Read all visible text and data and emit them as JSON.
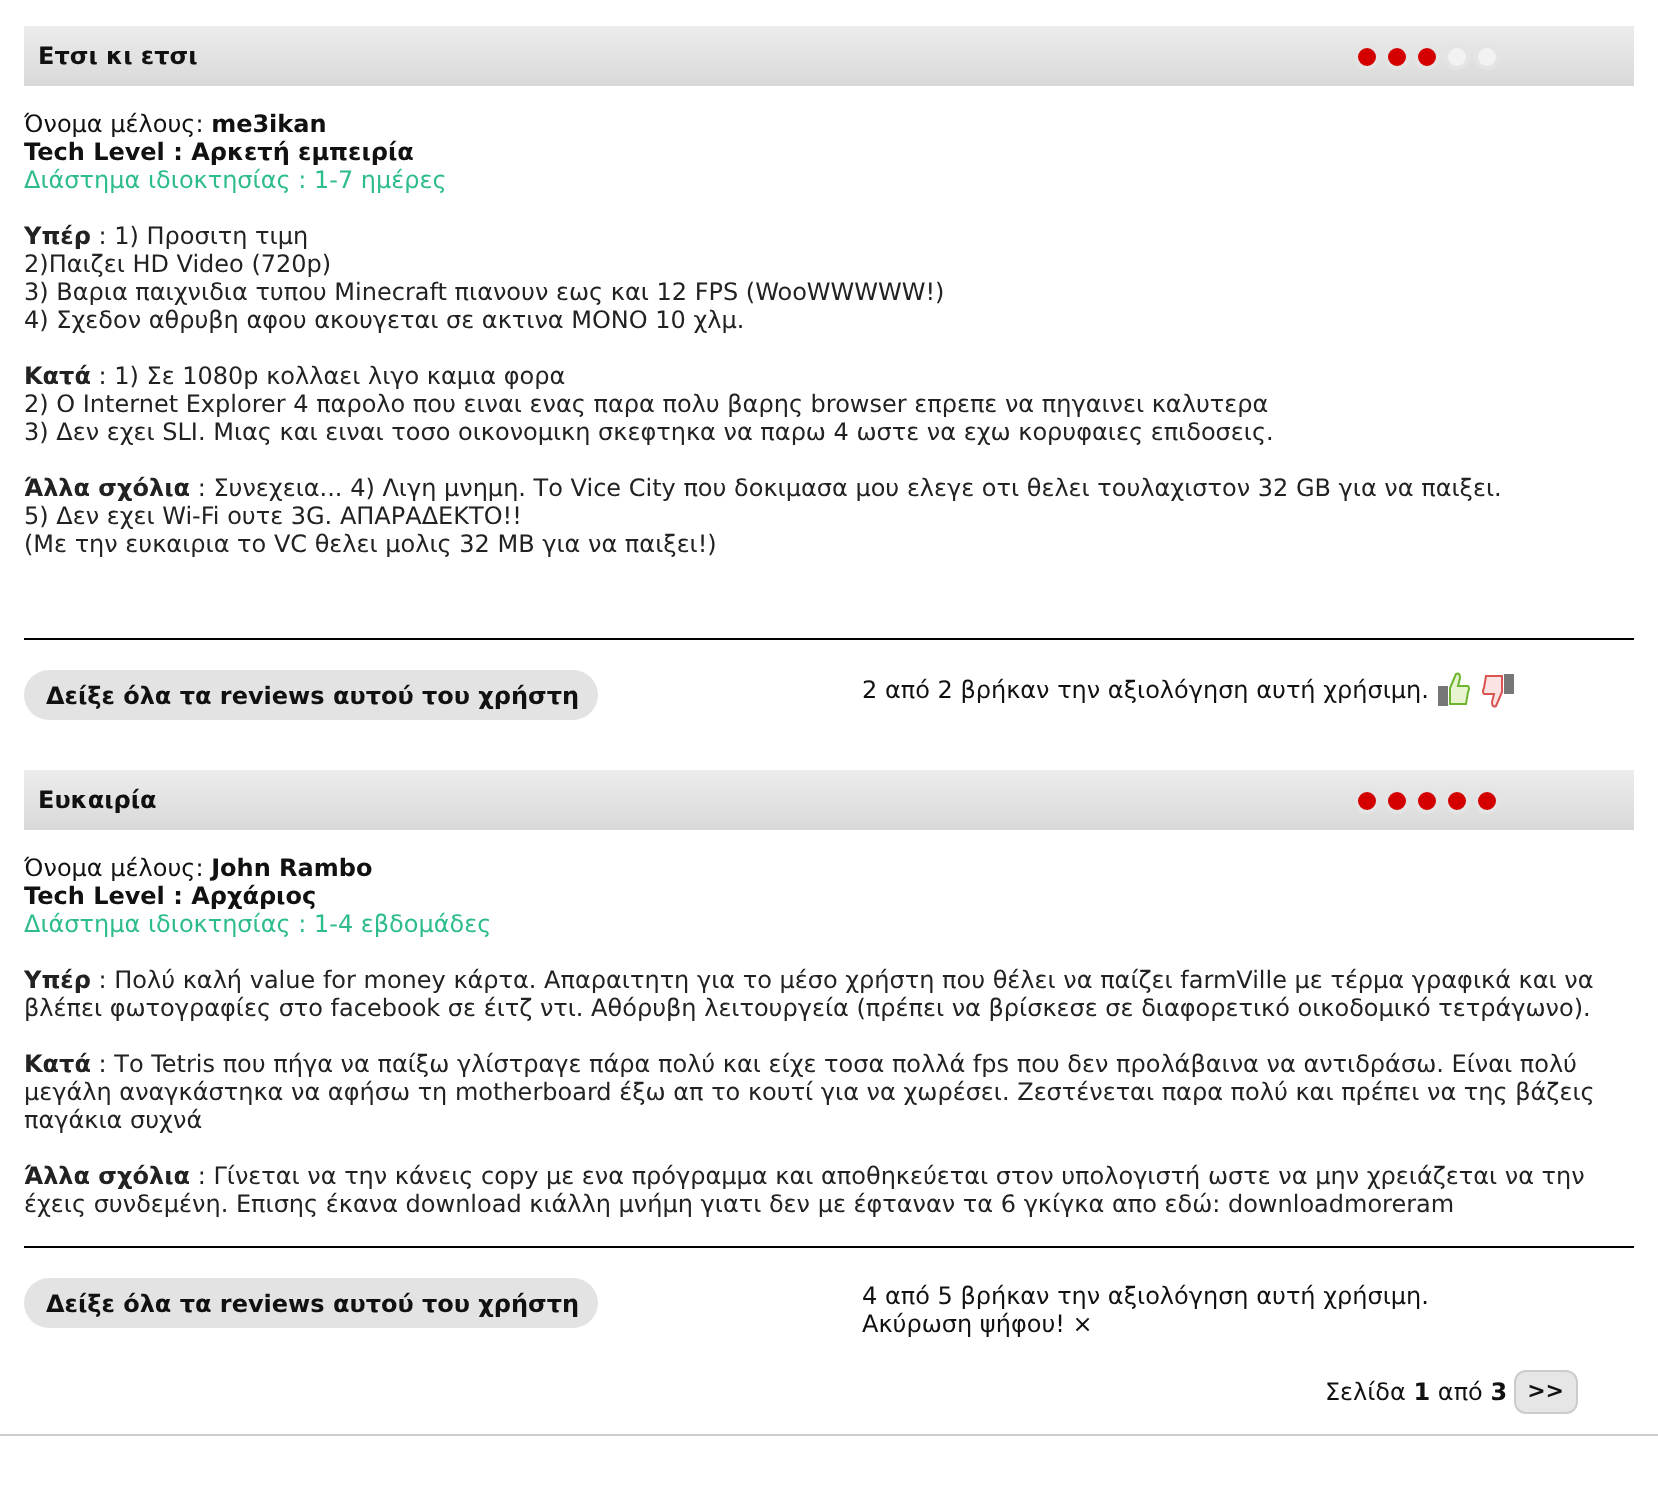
{
  "reviews": [
    {
      "title": "Ετσι κι ετσι",
      "stars": 3,
      "member": "Όνομα μέλους: **me3ikan**",
      "tech_level": "Tech Level : Αρκετή εμπειρία",
      "ownership": "Διάστημα ιδιοκτησίας : 1-7 ημέρες",
      "sections": [
        "**Υπέρ** : 1) Προσιτη τιμη\n2)Παιζει HD Video (720p)\n3) Βαρια παιχνιδια τυπου Minecraft πιανουν εως και 12 FPS (WooWWWWW!)\n4) Σχεδον αθρυβη αφου ακουγεται σε ακτινα ΜΟΝΟ 10 χλμ.",
        "**Κατά** : 1) Σε 1080p κολλαει λιγο καμια φορα\n2) Ο Internet Explorer 4 παρολο που ειναι ενας παρα πολυ βαρης browser επρεπε να πηγαινει καλυτερα\n3) Δεν εχει SLI. Μιας και ειναι τοσο οικονομικη σκεφτηκα να παρω 4 ωστε να εχω κορυφαιες επιδοσεις.",
        "**Άλλα σχόλια** : Συνεχεια... 4) Λιγη μνημη. Το Vice City που δοκιμασα μου ελεγε οτι θελει τουλαχιστον 32 GB για να παιξει.\n5) Δεν εχει Wi-Fi ουτε 3G. ΑΠΑΡΑΔΕΚΤΟ!!\n(Με την ευκαιρια το VC θελει μολις 32 MB για να παιξει!)"
      ],
      "show_all_button": "Δείξε όλα τα reviews αυτού του χρήστη",
      "helpful": "2 από 2 βρήκαν την αξιολόγηση αυτή χρήσιμη."
    },
    {
      "title": "Ευκαιρία",
      "stars": 5,
      "member": "Όνομα μέλους: **John Rambo**",
      "tech_level": "Tech Level : Αρχάριος",
      "ownership": "Διάστημα ιδιοκτησίας : 1-4 εβδομάδες",
      "sections": [
        "**Υπέρ** : Πολύ καλή value for money κάρτα. Απαραιτητη για το μέσο χρήστη που θέλει να παίζει farmVille με τέρμα γραφικά και να βλέπει φωτογραφίες στο facebook σε έιτζ ντι. Αθόρυβη λειτουργεία (πρέπει να βρίσκεσε σε διαφορετικό οικοδομικό τετράγωνο).",
        "**Κατά** : Το Tetris που πήγα να παίξω γλίστραγε πάρα πολύ και είχε τοσα πολλά fps που δεν προλάβαινα να αντιδράσω. Είναι πολύ μεγάλη αναγκάστηκα να αφήσω τη motherboard έξω απ το κουτί για να χωρέσει. Ζεστένεται παρα πολύ και πρέπει να της βάζεις παγάκια συχνά",
        "**Άλλα σχόλια** : Γίνεται να την κάνεις copy με ενα πρόγραμμα και αποθηκεύεται στον υπολογιστή ωστε να μην χρειάζεται να την έχεις συνδεμένη. Επισης έκανα download κιάλλη μνήμη γιατι δεν με έφταναν τα 6 γκίγκα απο εδώ: downloadmoreram"
      ],
      "show_all_button": "Δείξε όλα τα reviews αυτού του χρήστη",
      "helpful": "4 από 5 βρήκαν την αξιολόγηση αυτή χρήσιμη.",
      "cancel_vote": "Ακύρωση ψήφου! ×"
    }
  ],
  "pagination": {
    "label": "Σελίδα **1** από **3**",
    "next_button": ">>"
  }
}
